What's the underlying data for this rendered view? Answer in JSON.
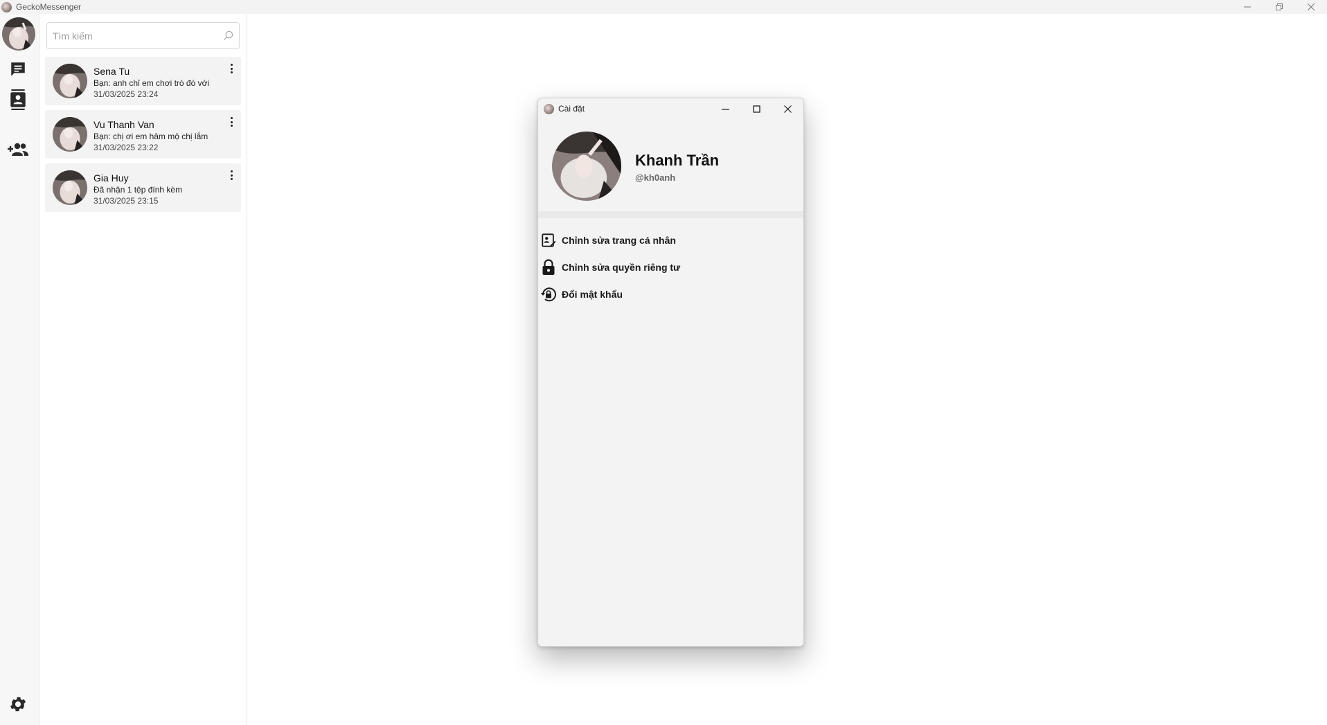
{
  "app": {
    "title": "GeckoMessenger"
  },
  "window_controls": {
    "minimize": "—",
    "restore": "❐",
    "close": "✕"
  },
  "search": {
    "placeholder": "Tìm kiếm",
    "value": ""
  },
  "conversations": [
    {
      "name": "Sena Tu",
      "last_message": "Bạn: anh chỉ em chơi trò đó với",
      "time": "31/03/2025 23:24"
    },
    {
      "name": "Vu Thanh Van",
      "last_message": "Bạn: chị ơi em hâm mộ chị lắm",
      "time": "31/03/2025 23:22"
    },
    {
      "name": "Gia Huy",
      "last_message": "Đã nhận 1 tệp đính kèm",
      "time": "31/03/2025 23:15"
    }
  ],
  "nav": {
    "icons": [
      "chat-icon",
      "contacts-icon",
      "add-friend-icon",
      "settings-gear-icon"
    ]
  },
  "settings_dialog": {
    "title": "Cài đặt",
    "profile": {
      "name": "Khanh Trần",
      "handle": "@kh0anh"
    },
    "menu": [
      {
        "label": "Chỉnh sửa trang cá nhân",
        "icon": "edit-profile-icon"
      },
      {
        "label": "Chỉnh sửa quyền riêng tư",
        "icon": "lock-icon"
      },
      {
        "label": "Đổi mật khẩu",
        "icon": "lock-reset-icon"
      }
    ]
  }
}
